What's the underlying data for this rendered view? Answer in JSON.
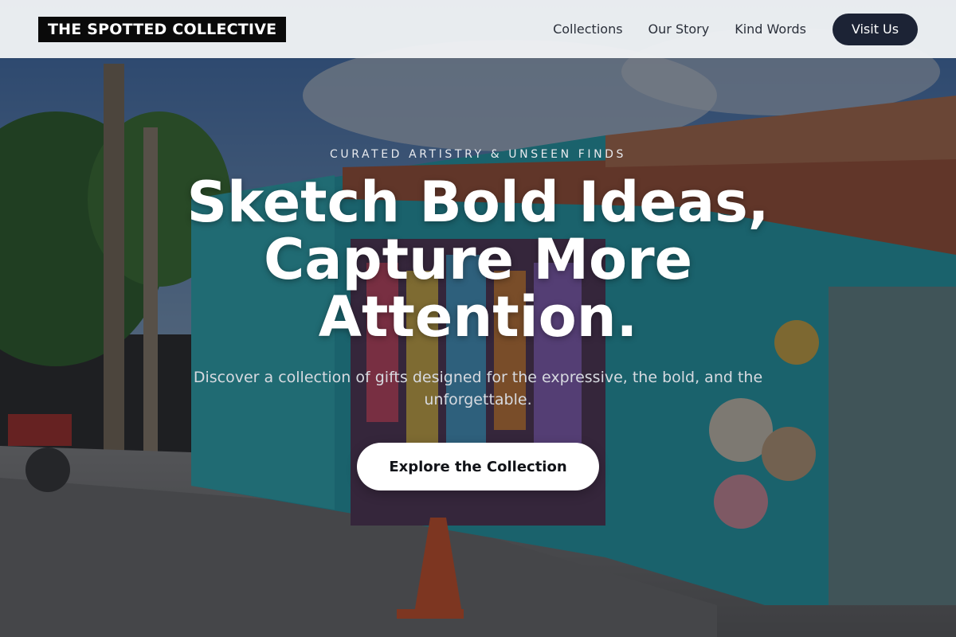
{
  "brand": {
    "name": "THE SPOTTED COLLECTIVE"
  },
  "nav": {
    "links": [
      {
        "label": "Collections"
      },
      {
        "label": "Our Story"
      },
      {
        "label": "Kind Words"
      }
    ],
    "cta_label": "Visit Us"
  },
  "hero": {
    "eyebrow": "CURATED ARTISTRY & UNSEEN FINDS",
    "headline": "Sketch Bold Ideas, Capture More Attention.",
    "subhead": "Discover a collection of gifts designed for the expressive, the bold, and the unforgettable.",
    "cta_label": "Explore the Collection",
    "background_image": "colorful turquoise roadside gift shop with hats and crafts"
  },
  "colors": {
    "nav_bg": "#f0f2f5",
    "brand_bg": "#0a0a0a",
    "visit_button_bg": "#1c2335",
    "cta_bg": "#ffffff",
    "cta_text": "#111318"
  }
}
